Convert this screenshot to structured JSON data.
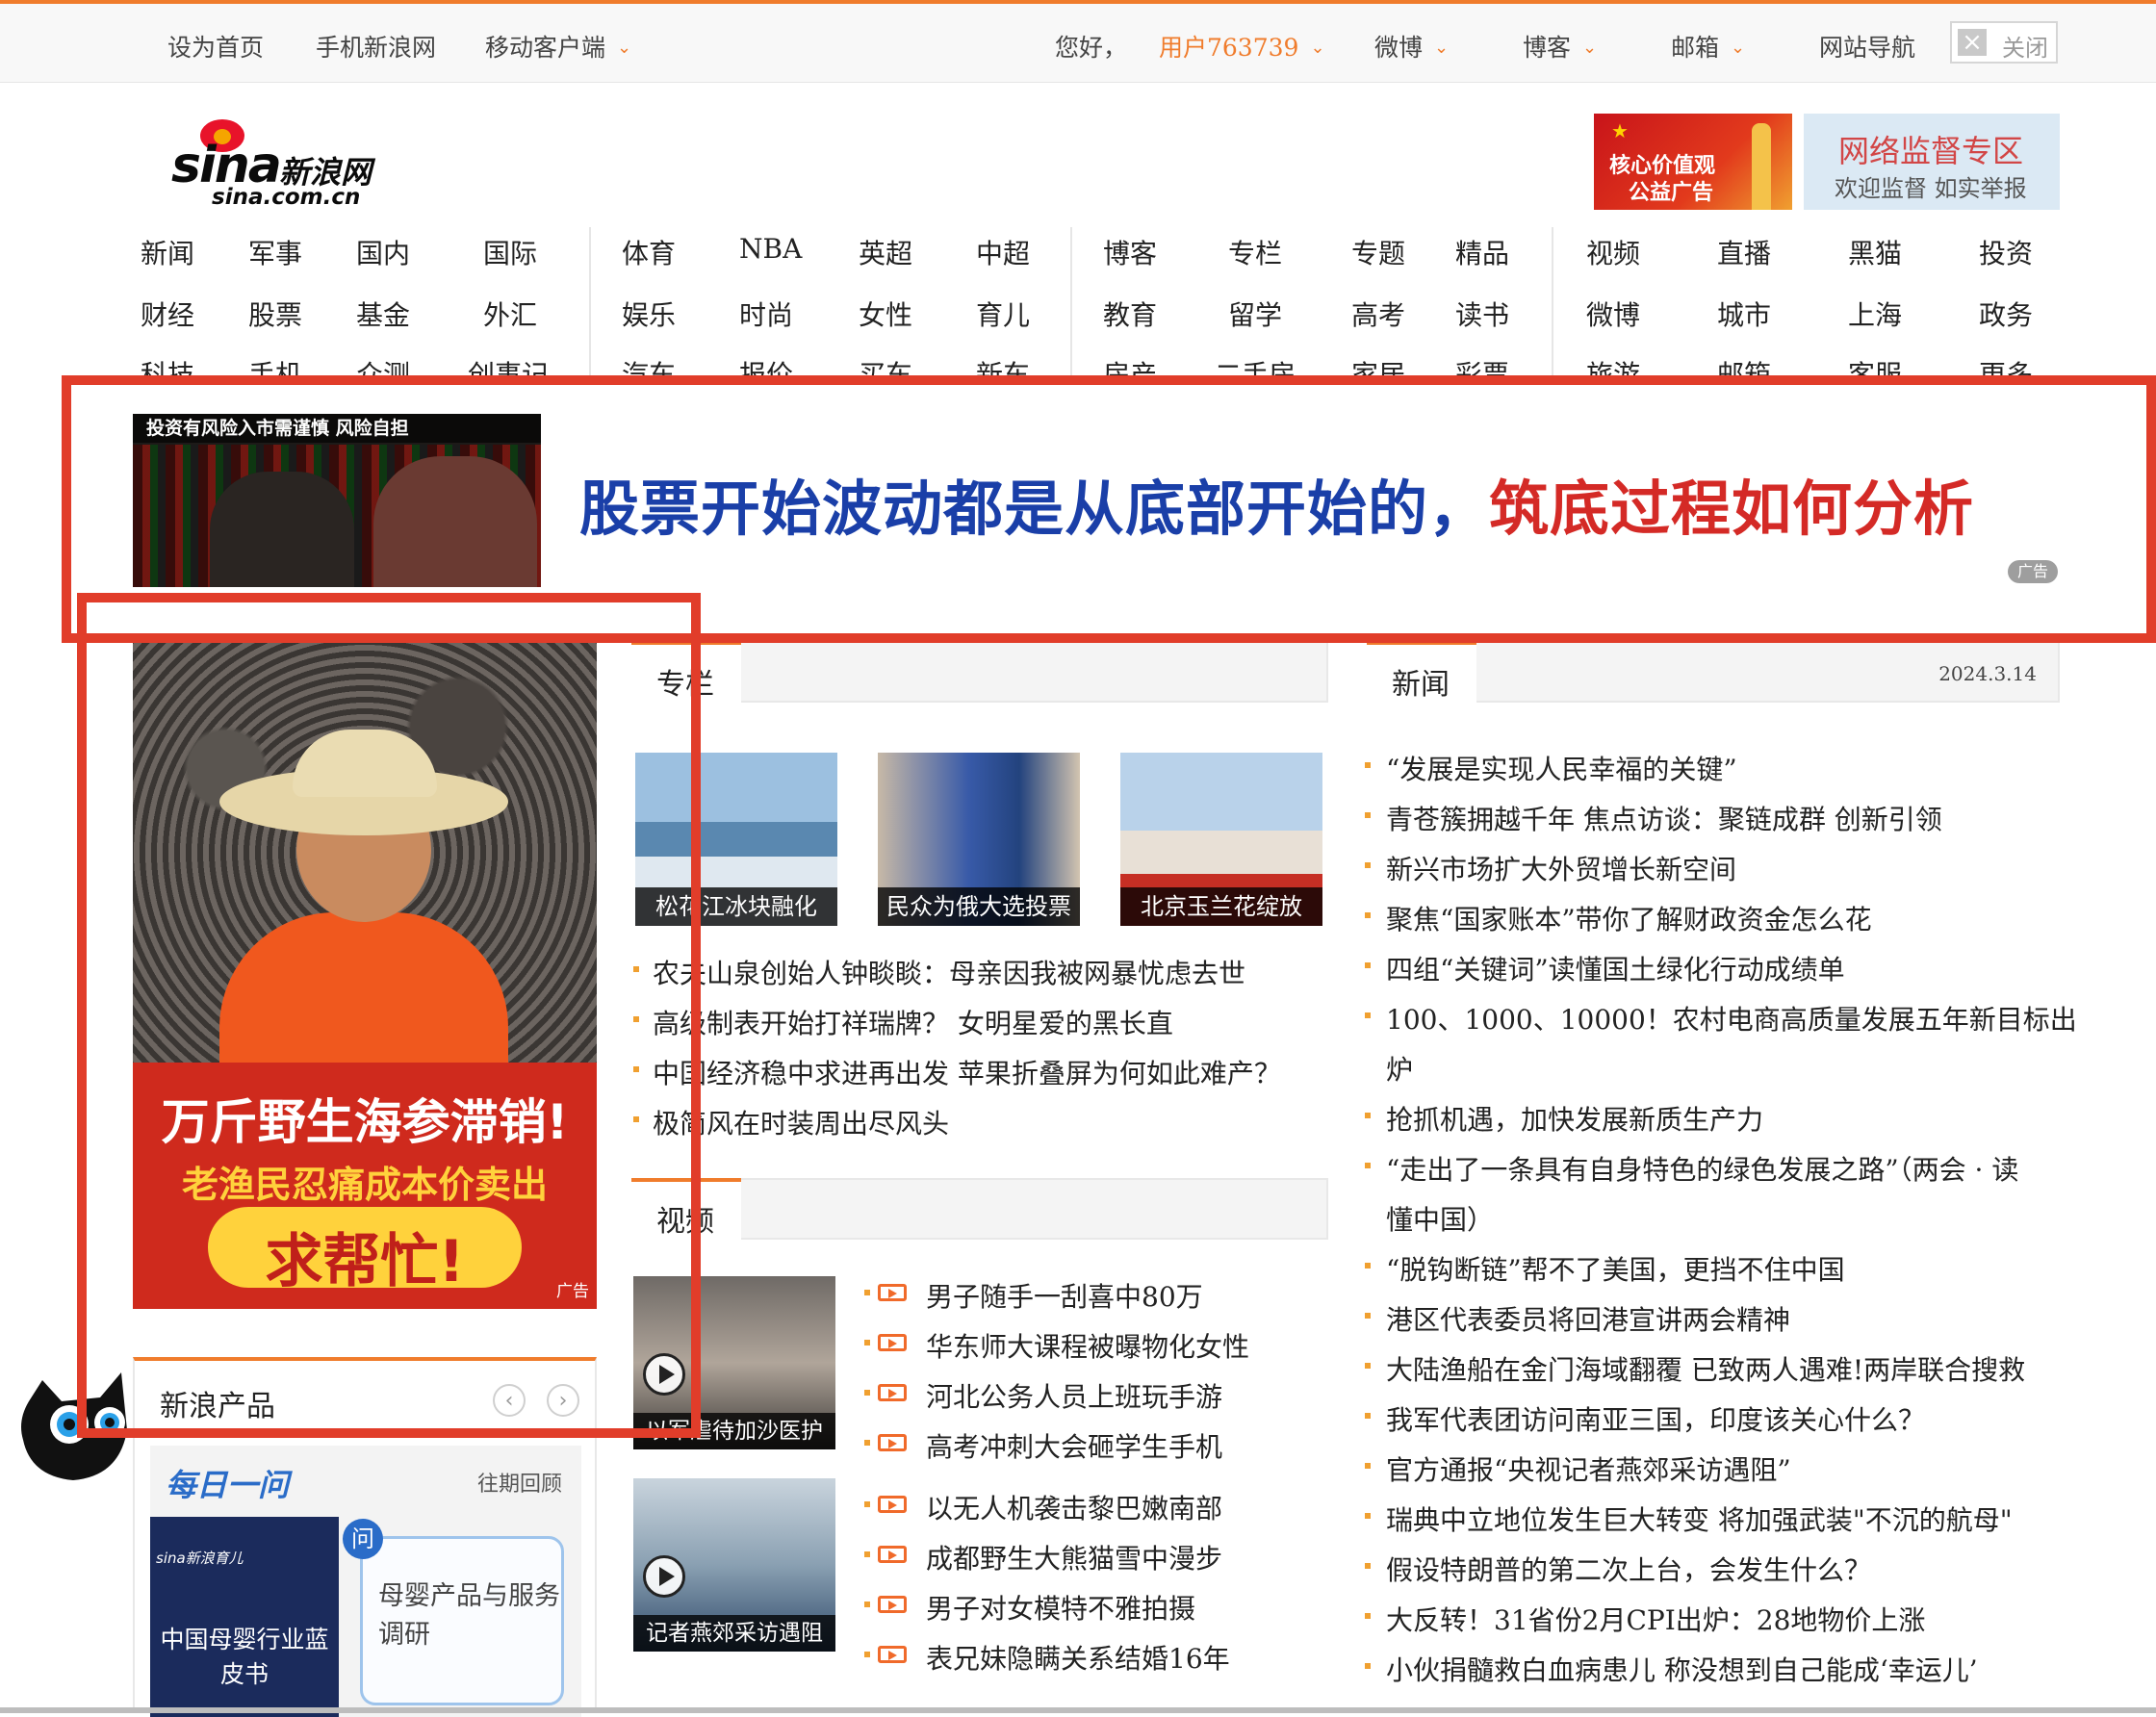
{
  "topbar": {
    "set_home": "设为首页",
    "mobile_sina": "手机新浪网",
    "mobile_client": "移动客户端",
    "greeting": "您好，",
    "username": "用户763739",
    "weibo": "微博",
    "blog": "博客",
    "mail": "邮箱",
    "site_nav": "网站导航",
    "close": "关闭"
  },
  "logo": {
    "word": "sina",
    "cn": "新浪网",
    "domain": "sina.com.cn"
  },
  "banners": {
    "left": {
      "line1": "核心价值观",
      "line2": "公益广告"
    },
    "right": {
      "line1": "网络监督专区",
      "line2": "欢迎监督 如实举报"
    }
  },
  "nav": {
    "g1": [
      "新闻",
      "军事",
      "国内",
      "国际",
      "财经",
      "股票",
      "基金",
      "外汇",
      "科技",
      "手机",
      "众测",
      "创事记"
    ],
    "g2": [
      "体育",
      "NBA",
      "英超",
      "中超",
      "娱乐",
      "时尚",
      "女性",
      "育儿",
      "汽车",
      "报价",
      "买车",
      "新车"
    ],
    "g3": [
      "博客",
      "专栏",
      "专题",
      "精品",
      "教育",
      "留学",
      "高考",
      "读书",
      "房产",
      "二手房",
      "家居",
      "彩票"
    ],
    "g4": [
      "视频",
      "直播",
      "黑猫",
      "投资",
      "微博",
      "城市",
      "上海",
      "政务",
      "旅游",
      "邮箱",
      "客服",
      "更多"
    ]
  },
  "ad_banner": {
    "image_warning": "投资有风险入市需谨慎 风险自担",
    "text_blue": "股票开始波动都是从底部开始的，",
    "text_red": "筑底过程如何分析",
    "tag": "广告"
  },
  "left_ad": {
    "line1": "万斤野生海参滞销!",
    "line2": "老渔民忍痛成本价卖出",
    "line3": "求帮忙!",
    "tag": "广告"
  },
  "products": {
    "title": "新浪产品",
    "prev": "‹",
    "next": "›",
    "daily": "每日一问",
    "review": "往期回顾",
    "q": "问",
    "book_top": "sina新浪育儿",
    "book_title": "中国母婴行业蓝皮书",
    "bubble": "母婴产品与服务调研"
  },
  "column": {
    "title": "专栏",
    "photos": [
      {
        "caption": "松花江冰块融化"
      },
      {
        "caption": "民众为俄大选投票"
      },
      {
        "caption": "北京玉兰花绽放"
      }
    ],
    "items": [
      "农夫山泉创始人钟睒睒：母亲因我被网暴忧虑去世",
      "高级制表开始打祥瑞牌？ 女明星爱的黑长直",
      "中国经济稳中求进再出发 苹果折叠屏为何如此难产？",
      "极简风在时装周出尽风头"
    ]
  },
  "video": {
    "title": "视频",
    "thumbs": [
      {
        "caption": "以军虐待加沙医护"
      },
      {
        "caption": "记者燕郊采访遇阻"
      }
    ],
    "items1": [
      "男子随手一刮喜中80万",
      "华东师大课程被曝物化女性",
      "河北公务人员上班玩手游",
      "高考冲刺大会砸学生手机"
    ],
    "items2": [
      "以无人机袭击黎巴嫩南部",
      "成都野生大熊猫雪中漫步",
      "男子对女模特不雅拍摄",
      "表兄妹隐瞒关系结婚16年"
    ]
  },
  "news": {
    "title": "新闻",
    "date": "2024.3.14",
    "items": [
      "“发展是实现人民幸福的关键”",
      "青苍簇拥越千年 焦点访谈：聚链成群 创新引领",
      "新兴市场扩大外贸增长新空间",
      "聚焦“国家账本”带你了解财政资金怎么花",
      "四组“关键词”读懂国土绿化行动成绩单",
      "100、1000、10000！农村电商高质量发展五年新目标出",
      "炉",
      "抢抓机遇，加快发展新质生产力",
      "“走出了一条具有自身特色的绿色发展之路”（两会 · 读",
      "懂中国）",
      "“脱钩断链”帮不了美国，更挡不住中国",
      "港区代表委员将回港宣讲两会精神",
      "大陆渔船在金门海域翻覆 已致两人遇难!两岸联合搜救",
      "我军代表团访问南亚三国，印度该关心什么？",
      "官方通报“央视记者燕郊采访遇阻”",
      "瑞典中立地位发生巨大转变 将加强武装\"不沉的航母\"",
      "假设特朗普的第二次上台，会发生什么？",
      "大反转！31省份2月CPI出炉：28地物价上涨",
      "小伙捐髓救白血病患儿 称没想到自己能成‘幸运儿’"
    ]
  },
  "colors": {
    "accent": "#f07c2c",
    "annotation": "#e13d2a",
    "ad_blue": "#1a3fa8",
    "ad_red": "#d42a26"
  }
}
